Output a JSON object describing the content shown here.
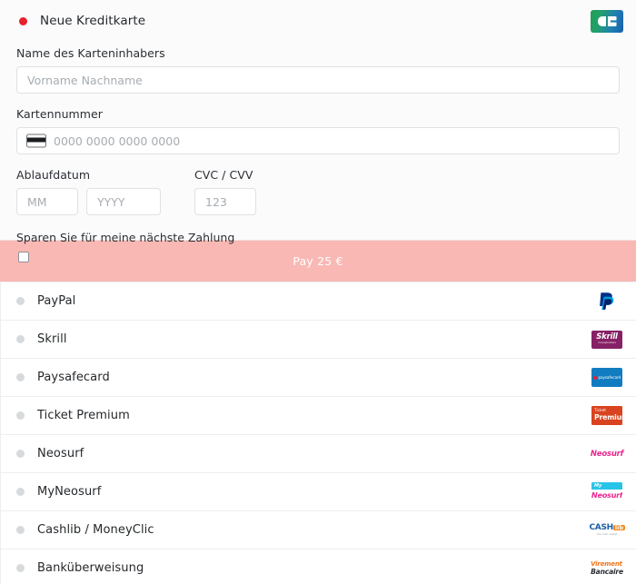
{
  "credit_card": {
    "header_label": "Neue Kreditkarte",
    "selected": true,
    "brand_logo": "cb-cartes-bancaires-logo",
    "accent_color": "#e8212a",
    "fields": {
      "cardholder_label": "Name des Karteninhabers",
      "cardholder_value": "",
      "cardholder_placeholder": "Vorname Nachname",
      "cardnumber_label": "Kartennummer",
      "cardnumber_value": "",
      "cardnumber_placeholder": "0000 0000 0000 0000",
      "expiry_label": "Ablaufdatum",
      "expiry_month_value": "",
      "expiry_month_placeholder": "MM",
      "expiry_year_value": "",
      "expiry_year_placeholder": "YYYY",
      "cvc_label": "CVC / CVV",
      "cvc_value": "",
      "cvc_placeholder": "123"
    },
    "save_card": {
      "label": "Sparen Sie für meine nächste Zahlung",
      "checked": false
    }
  },
  "pay_button": {
    "label": "Pay 25 €",
    "amount": "25",
    "currency": "€",
    "background_color": "#f9b8b4",
    "text_color": "#ffffff"
  },
  "payment_methods": [
    {
      "label": "PayPal",
      "logo": "paypal-logo",
      "selected": false
    },
    {
      "label": "Skrill",
      "logo": "skrill-logo",
      "selected": false
    },
    {
      "label": "Paysafecard",
      "logo": "paysafecard-logo",
      "selected": false
    },
    {
      "label": "Ticket Premium",
      "logo": "ticket-premium-logo",
      "selected": false
    },
    {
      "label": "Neosurf",
      "logo": "neosurf-logo",
      "selected": false
    },
    {
      "label": "MyNeosurf",
      "logo": "myneosurf-logo",
      "selected": false
    },
    {
      "label": "Cashlib / MoneyClic",
      "logo": "cashlib-logo",
      "selected": false
    },
    {
      "label": "Banküberweisung",
      "logo": "virement-bancaire-logo",
      "selected": false
    }
  ],
  "brand_text": {
    "skrill_main": "Skrill",
    "skrill_sub": "moneybookers",
    "paysafe": "paysafecard",
    "ticket_top": "Ticket",
    "ticket_main": "Premium",
    "neosurf": "Neosurf",
    "myneosurf_top": "My",
    "myneosurf_main": "Neosurf",
    "cashlib_main": "CASH",
    "cashlib_accent": "lib",
    "cashlib_sub": "the cash wallet",
    "virement_top": "Virement",
    "virement_main": "Bancaire"
  }
}
